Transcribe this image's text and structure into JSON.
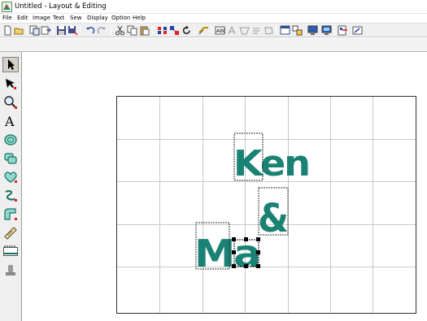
{
  "window": {
    "title": "Untitled - Layout & Editing",
    "icon": "app-logo-icon"
  },
  "menu": [
    "File",
    "Edit",
    "Image",
    "Text",
    "Sew",
    "Display",
    "Option",
    "Help"
  ],
  "toolbar": {
    "buttons": [
      "new-icon",
      "open-icon",
      "import-icon",
      "export-icon",
      "save-icon",
      "save-as-icon",
      "undo-icon",
      "redo-icon",
      "cut-icon",
      "copy-icon",
      "paste-icon",
      "mirror-icon",
      "group-icon",
      "rotate-icon",
      "arrange-icon",
      "text-attribute-icon",
      "sewing-attribute-icon",
      "pattern-icon",
      "transfer-icon",
      "check-sewing-icon",
      "design-settings-icon",
      "object-properties-icon",
      "preview-icon",
      "realistic-preview-icon",
      "send-to-card-icon",
      "write-icon"
    ]
  },
  "tools": [
    "select-tool-icon",
    "point-edit-tool-icon",
    "zoom-tool-icon",
    "text-tool-icon",
    "circle-tool-icon",
    "rectangle-tool-icon",
    "stitch-tool-icon",
    "outline-tool-icon",
    "fill-tool-icon",
    "measure-tool-icon",
    "stamp-tool-icon",
    "hoop-tool-icon"
  ],
  "design": {
    "text_color": "#1a8274",
    "grid": true,
    "lines": [
      {
        "text": "Ken"
      },
      {
        "text": "&"
      },
      {
        "text": "Ma"
      }
    ]
  },
  "colors": {
    "accent_teal": "#1a8274",
    "toolbar_bg": "#efefef",
    "grid_line": "#c8c8c8",
    "selection": "#000000"
  }
}
